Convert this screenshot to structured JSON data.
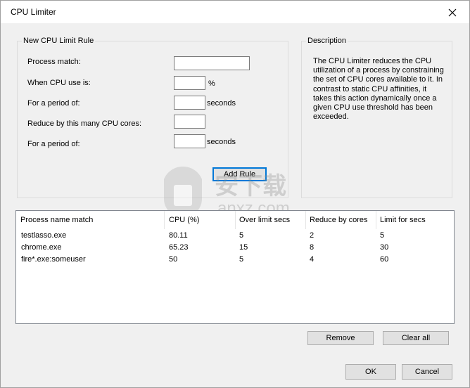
{
  "window": {
    "title": "CPU Limiter",
    "close_icon": "close-icon"
  },
  "rule_group": {
    "label": "New CPU Limit Rule",
    "process_match_label": "Process match:",
    "process_match_value": "",
    "cpu_use_label": "When CPU use is:",
    "cpu_use_value": "",
    "cpu_use_unit": "%",
    "period1_label": "For a period of:",
    "period1_value": "",
    "period1_unit": "seconds",
    "cores_label": "Reduce by this many CPU cores:",
    "cores_value": "",
    "period2_label": "For a period of:",
    "period2_value": "",
    "period2_unit": "seconds",
    "add_rule_label": "Add Rule"
  },
  "description": {
    "label": "Description",
    "text": "The CPU Limiter reduces the CPU utilization of a process by constraining the set of CPU cores available to it. In contrast to static CPU affinities, it takes this action dynamically once a given CPU use threshold has been exceeded."
  },
  "table": {
    "columns": [
      "Process name match",
      "CPU (%)",
      "Over limit secs",
      "Reduce by cores",
      "Limit for secs"
    ],
    "rows": [
      [
        "testlasso.exe",
        "80.11",
        "5",
        "2",
        "5"
      ],
      [
        "chrome.exe",
        "65.23",
        "15",
        "8",
        "30"
      ],
      [
        "fire*.exe:someuser",
        "50",
        "5",
        "4",
        "60"
      ]
    ]
  },
  "buttons": {
    "remove": "Remove",
    "clear_all": "Clear all",
    "ok": "OK",
    "cancel": "Cancel"
  },
  "watermark": {
    "text_cn": "安下载",
    "text_en": "anxz.com"
  }
}
